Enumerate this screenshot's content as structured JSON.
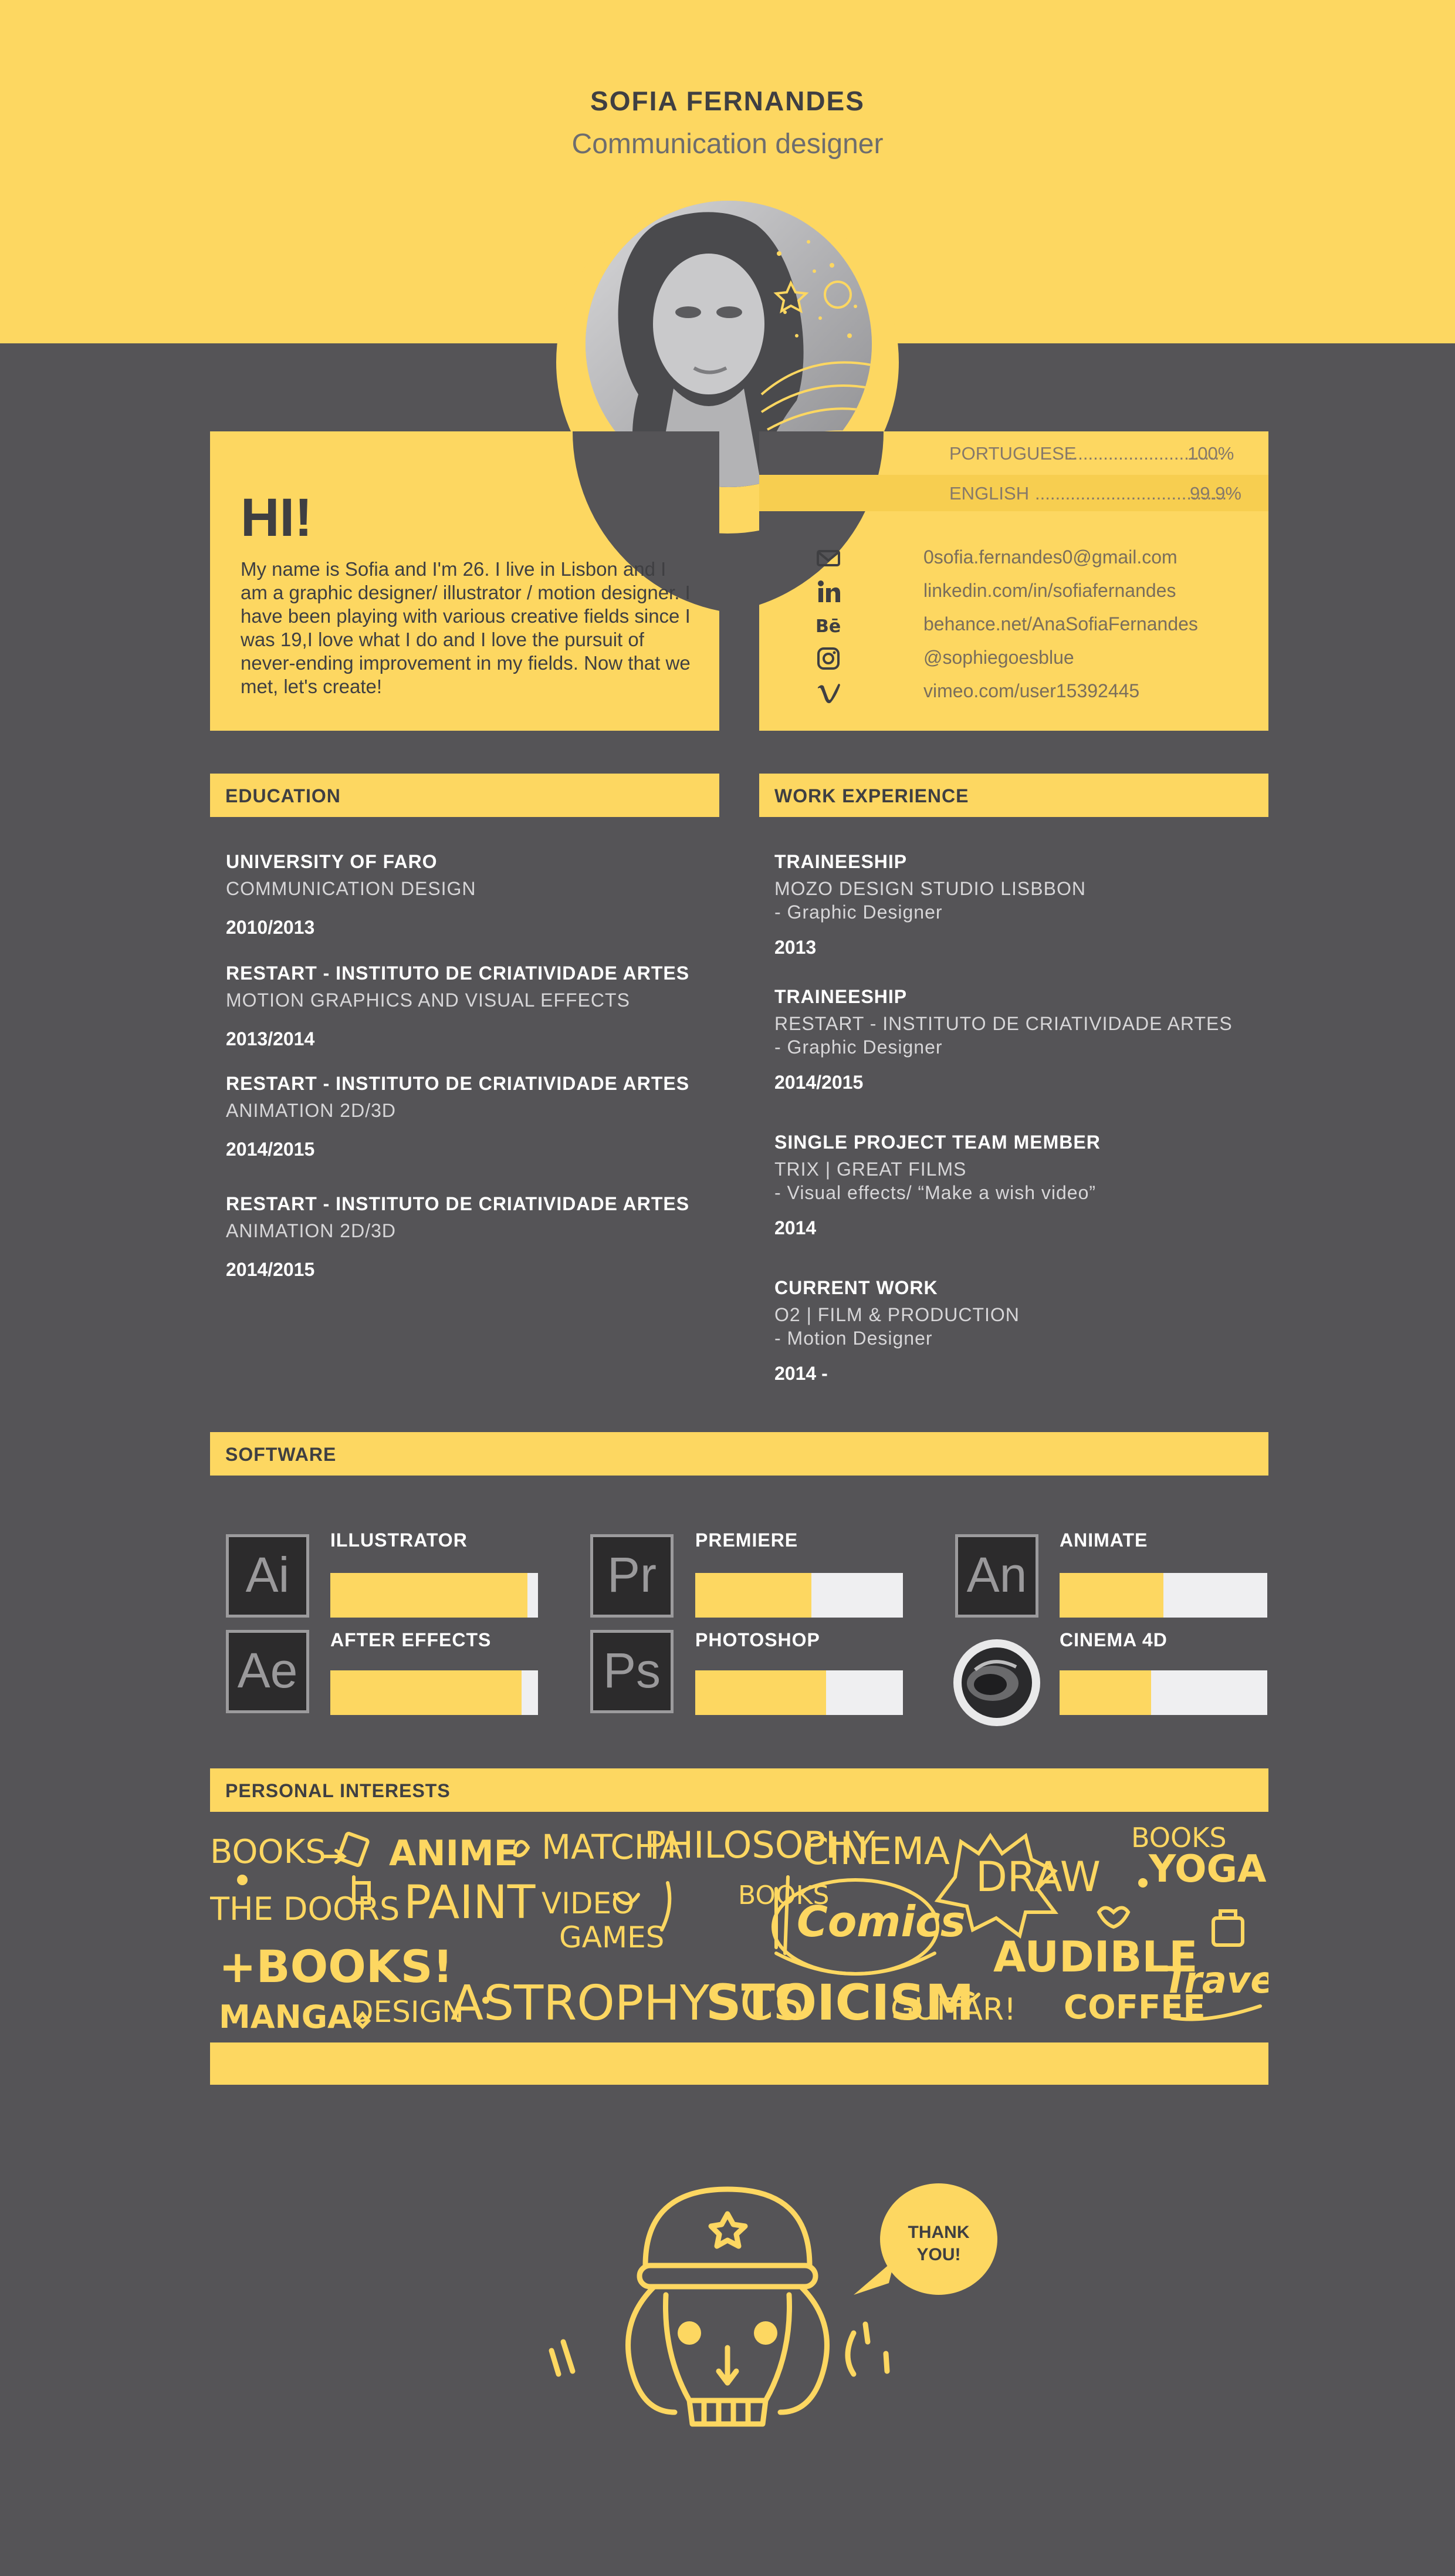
{
  "header": {
    "name": "SOFIA FERNANDES",
    "role": "Communication designer"
  },
  "intro": {
    "greeting": "HI!",
    "text": "My name is Sofia and I'm 26. I live in Lisbon and I am a graphic designer/ illustrator / motion designer. I have been playing with various creative fields since I was 19,I love what I do and I love the pursuit of never-ending improvement in my fields. Now that we met, let's create!"
  },
  "languages": [
    {
      "name": "PORTUGUESE",
      "dots": "...............................",
      "value": "100%"
    },
    {
      "name": "ENGLISH",
      "dots": "......................................",
      "value": "99.9%"
    }
  ],
  "contacts": [
    {
      "icon": "mail-icon",
      "text": "0sofia.fernandes0@gmail.com"
    },
    {
      "icon": "linkedin-icon",
      "text": "linkedin.com/in/sofiafernandes"
    },
    {
      "icon": "behance-icon",
      "text": "behance.net/AnaSofiaFernandes"
    },
    {
      "icon": "instagram-icon",
      "text": "@sophiegoesblue"
    },
    {
      "icon": "vimeo-icon",
      "text": "vimeo.com/user15392445"
    }
  ],
  "education": {
    "title": "EDUCATION",
    "entries": [
      {
        "school": "UNIVERSITY OF FARO",
        "course": "COMMUNICATION DESIGN",
        "years": "2010/2013"
      },
      {
        "school": "RESTART - INSTITUTO DE CRIATIVIDADE ARTES",
        "course": "MOTION GRAPHICS AND VISUAL EFFECTS",
        "years": "2013/2014"
      },
      {
        "school": "RESTART - INSTITUTO DE CRIATIVIDADE ARTES",
        "course": "ANIMATION 2D/3D",
        "years": "2014/2015"
      },
      {
        "school": "RESTART - INSTITUTO DE CRIATIVIDADE ARTES",
        "course": "ANIMATION 2D/3D",
        "years": "2014/2015"
      }
    ]
  },
  "work": {
    "title": "WORK EXPERIENCE",
    "entries": [
      {
        "role": "TRAINEESHIP",
        "company": "MOZO DESIGN STUDIO LISBBON",
        "detail": "- Graphic Designer",
        "years": "2013"
      },
      {
        "role": "TRAINEESHIP",
        "company": "RESTART - INSTITUTO DE CRIATIVIDADE ARTES",
        "detail": "- Graphic Designer",
        "years": "2014/2015"
      },
      {
        "role": "SINGLE PROJECT TEAM MEMBER",
        "company": "TRIX | GREAT FILMS",
        "detail": "- Visual effects/ “Make a wish video”",
        "years": "2014"
      },
      {
        "role": "CURRENT WORK",
        "company": "O2 | FILM & PRODUCTION",
        "detail": "- Motion Designer",
        "years": "2014 -"
      }
    ]
  },
  "software": {
    "title": "SOFTWARE",
    "items": [
      {
        "name": "ILLUSTRATOR",
        "abbr": "Ai",
        "level": 0.95
      },
      {
        "name": "PREMIERE",
        "abbr": "Pr",
        "level": 0.56
      },
      {
        "name": "ANIMATE",
        "abbr": "An",
        "level": 0.5
      },
      {
        "name": "AFTER EFFECTS",
        "abbr": "Ae",
        "level": 0.92
      },
      {
        "name": "PHOTOSHOP",
        "abbr": "Ps",
        "level": 0.63
      },
      {
        "name": "CINEMA 4D",
        "abbr": "",
        "level": 0.44
      }
    ]
  },
  "interests": {
    "title": "PERSONAL INTERESTS",
    "words": [
      "BOOKS",
      "ANIME",
      "MATCHA",
      "PHILOSOPHY",
      "CINEMA",
      "DRAW",
      "BOOKS",
      "YOGA",
      "THE DOORS",
      "PAINT",
      "VIDEO",
      "GAMES",
      "BOOKS",
      "Comics",
      "+BOOKS!",
      "AUDIBLE",
      "MANGA",
      "DESIGN",
      "ASTROPHYSCS",
      "STOICISM",
      "GUITAR!",
      "COFFEE",
      "Travel"
    ]
  },
  "footer": {
    "bubble_line1": "THANK",
    "bubble_line2": "YOU!"
  },
  "colors": {
    "accent": "#fdd761",
    "background": "#555457",
    "text_dark": "#3f3f42"
  }
}
